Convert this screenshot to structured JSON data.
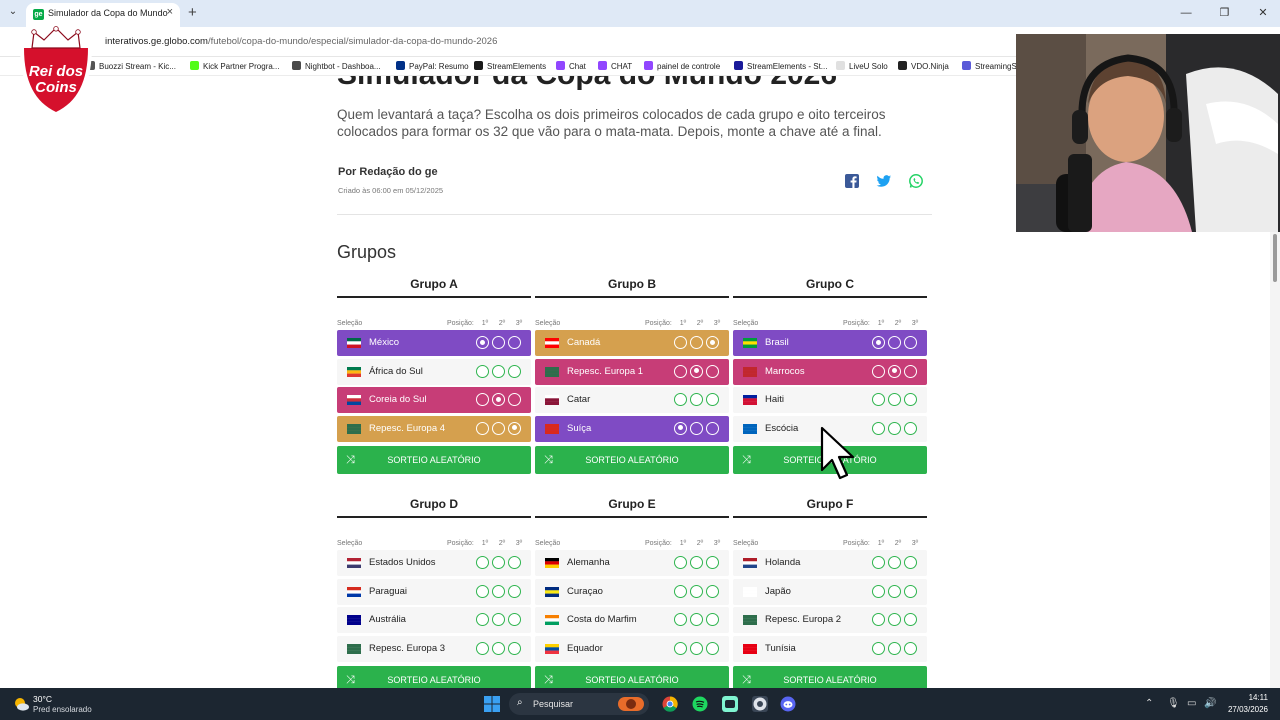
{
  "browser": {
    "tab_title": "Simulador da Copa do Mundo",
    "tab_close": "×",
    "new_tab": "+",
    "url_host": "interativos.ge.globo.com",
    "url_path": "/futebol/copa-do-mundo/especial/simulador-da-copa-do-mundo-2026",
    "bookmarks": [
      {
        "label": "Buozzi Stream - Kic...",
        "color": "#555555"
      },
      {
        "label": "Kick Partner Progra...",
        "color": "#53fc18"
      },
      {
        "label": "Nightbot - Dashboa...",
        "color": "#4a4a4a"
      },
      {
        "label": "PayPal: Resumo",
        "color": "#003087"
      },
      {
        "label": "StreamElements",
        "color": "#1a1a1a"
      },
      {
        "label": "Chat",
        "color": "#9146ff"
      },
      {
        "label": "CHAT",
        "color": "#9146ff"
      },
      {
        "label": "painel de controle",
        "color": "#9146ff"
      },
      {
        "label": "StreamElements - St...",
        "color": "#1a1a9a"
      },
      {
        "label": "LiveU Solo",
        "color": "#e0e0e0"
      },
      {
        "label": "VDO.Ninja",
        "color": "#222222"
      },
      {
        "label": "StreamingS",
        "color": "#5a5ad8"
      }
    ]
  },
  "logo": {
    "line1": "Rei dos",
    "line2": "Coins"
  },
  "page": {
    "title": "Simulador da Copa do Mundo 2026",
    "intro": "Quem levantará a taça? Escolha os dois primeiros colocados de cada grupo e oito terceiros colocados para formar os 32 que vão para o mata-mata. Depois, monte a chave até a final.",
    "author": "Por Redação do ge",
    "date": "Criado às 06:00 em 05/12/2025",
    "groups_heading": "Grupos",
    "col_selecao": "Seleção",
    "col_posicao": "Posição:",
    "pos1": "1º",
    "pos2": "2º",
    "pos3": "3º",
    "sorteio": "SORTEIO ALEATÓRIO",
    "groups": [
      {
        "name": "Grupo A",
        "teams": [
          {
            "name": "México",
            "style": "purple",
            "sel": 1,
            "flag": [
              "#006847",
              "#ffffff",
              "#ce1126"
            ]
          },
          {
            "name": "África do Sul",
            "style": "",
            "sel": 0,
            "flag": [
              "#007a4d",
              "#ffb612",
              "#de3831"
            ]
          },
          {
            "name": "Coreia do Sul",
            "style": "magenta",
            "sel": 2,
            "flag": [
              "#ffffff",
              "#cd2e3a",
              "#0047a0"
            ]
          },
          {
            "name": "Repesc. Europa 4",
            "style": "gold",
            "sel": 3,
            "flag": [
              "#2e6e4c",
              "#2e6e4c",
              "#2e6e4c"
            ]
          }
        ]
      },
      {
        "name": "Grupo B",
        "teams": [
          {
            "name": "Canadá",
            "style": "gold",
            "sel": 3,
            "flag": [
              "#ff0000",
              "#ffffff",
              "#ff0000"
            ]
          },
          {
            "name": "Repesc. Europa 1",
            "style": "magenta",
            "sel": 2,
            "flag": [
              "#2e6e4c",
              "#2e6e4c",
              "#2e6e4c"
            ]
          },
          {
            "name": "Catar",
            "style": "",
            "sel": 0,
            "flag": [
              "#ffffff",
              "#8a1538",
              "#8a1538"
            ]
          },
          {
            "name": "Suíça",
            "style": "purple",
            "sel": 1,
            "flag": [
              "#da291c",
              "#da291c",
              "#da291c"
            ]
          }
        ]
      },
      {
        "name": "Grupo C",
        "teams": [
          {
            "name": "Brasil",
            "style": "purple",
            "sel": 1,
            "flag": [
              "#009c3b",
              "#ffdf00",
              "#009c3b"
            ]
          },
          {
            "name": "Marrocos",
            "style": "magenta",
            "sel": 2,
            "flag": [
              "#c1272d",
              "#c1272d",
              "#c1272d"
            ]
          },
          {
            "name": "Haiti",
            "style": "",
            "sel": 0,
            "flag": [
              "#00209f",
              "#d21034",
              "#d21034"
            ]
          },
          {
            "name": "Escócia",
            "style": "",
            "sel": 0,
            "flag": [
              "#0065bd",
              "#0065bd",
              "#0065bd"
            ]
          }
        ]
      },
      {
        "name": "Grupo D",
        "teams": [
          {
            "name": "Estados Unidos",
            "style": "",
            "sel": 0,
            "flag": [
              "#b22234",
              "#ffffff",
              "#3c3b6e"
            ]
          },
          {
            "name": "Paraguai",
            "style": "",
            "sel": 0,
            "flag": [
              "#d52b1e",
              "#ffffff",
              "#0038a8"
            ]
          },
          {
            "name": "Austrália",
            "style": "",
            "sel": 0,
            "flag": [
              "#00008b",
              "#00008b",
              "#00008b"
            ]
          },
          {
            "name": "Repesc. Europa 3",
            "style": "",
            "sel": 0,
            "flag": [
              "#2e6e4c",
              "#2e6e4c",
              "#2e6e4c"
            ]
          }
        ]
      },
      {
        "name": "Grupo E",
        "teams": [
          {
            "name": "Alemanha",
            "style": "",
            "sel": 0,
            "flag": [
              "#000000",
              "#dd0000",
              "#ffce00"
            ]
          },
          {
            "name": "Curaçao",
            "style": "",
            "sel": 0,
            "flag": [
              "#002b7f",
              "#f9e814",
              "#002b7f"
            ]
          },
          {
            "name": "Costa do Marfim",
            "style": "",
            "sel": 0,
            "flag": [
              "#f77f00",
              "#ffffff",
              "#009e60"
            ]
          },
          {
            "name": "Equador",
            "style": "",
            "sel": 0,
            "flag": [
              "#ffd100",
              "#034ea2",
              "#ef3340"
            ]
          }
        ]
      },
      {
        "name": "Grupo F",
        "teams": [
          {
            "name": "Holanda",
            "style": "",
            "sel": 0,
            "flag": [
              "#ae1c28",
              "#ffffff",
              "#21468b"
            ]
          },
          {
            "name": "Japão",
            "style": "",
            "sel": 0,
            "flag": [
              "#ffffff",
              "#ffffff",
              "#ffffff"
            ]
          },
          {
            "name": "Repesc. Europa 2",
            "style": "",
            "sel": 0,
            "flag": [
              "#2e6e4c",
              "#2e6e4c",
              "#2e6e4c"
            ]
          },
          {
            "name": "Tunísia",
            "style": "",
            "sel": 0,
            "flag": [
              "#e70013",
              "#e70013",
              "#e70013"
            ]
          }
        ]
      }
    ]
  },
  "taskbar": {
    "temp": "30°C",
    "condition": "Pred ensolarado",
    "search": "Pesquisar",
    "time": "14:11",
    "date": "27/03/2026"
  }
}
